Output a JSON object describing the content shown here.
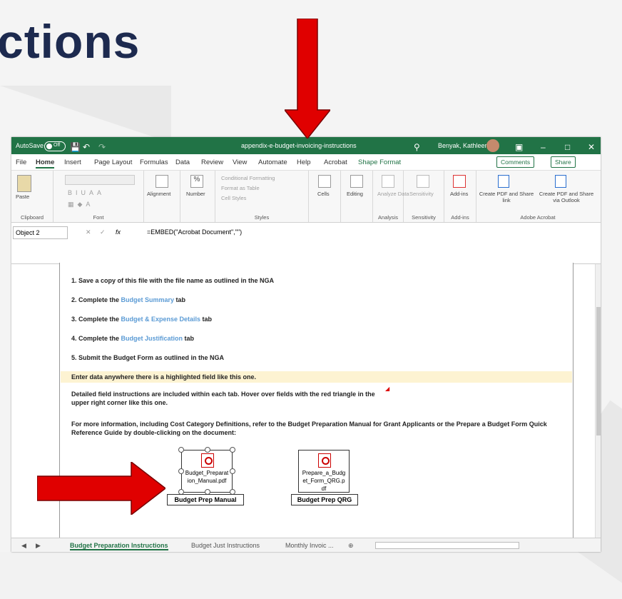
{
  "slide": {
    "title": "ctions"
  },
  "titlebar": {
    "autosave": "AutoSave",
    "toggle": "Off",
    "filename": "appendix-e-budget-invoicing-instructions",
    "user": "Benyak, Kathleen"
  },
  "menu": {
    "items": [
      "File",
      "Home",
      "Insert",
      "Page Layout",
      "Formulas",
      "Data",
      "Review",
      "View",
      "Automate",
      "Help",
      "Acrobat",
      "Shape Format"
    ],
    "comments": "Comments",
    "share": "Share"
  },
  "ribbon": {
    "paste": "Paste",
    "clipboard": "Clipboard",
    "font": "Font",
    "alignment": "Alignment",
    "number": "Number",
    "conditional": "Conditional Formatting",
    "format_table": "Format as Table",
    "cell_styles": "Cell Styles",
    "styles": "Styles",
    "cells": "Cells",
    "editing": "Editing",
    "analyze": "Analyze Data",
    "analysis": "Analysis",
    "sensitivity": "Sensitivity",
    "addins": "Add-ins",
    "create_pdf": "Create PDF and Share link",
    "create_pdf_outlook": "Create PDF and Share via Outlook",
    "adobe": "Adobe Acrobat"
  },
  "formula": {
    "namebox": "Object 2",
    "fx": "fx",
    "content": "=EMBED(\"Acrobat Document\",\"\")"
  },
  "doc": {
    "step1": "1. Save a copy of this file with the file name as outlined in the NGA",
    "step2_pre": "2. Complete the ",
    "step2_link": "Budget Summary",
    "step2_post": " tab",
    "step3_pre": "3. Complete the ",
    "step3_link": "Budget & Expense Details",
    "step3_post": " tab",
    "step4_pre": "4. Complete the ",
    "step4_link": "Budget Justification",
    "step4_post": " tab",
    "step5": "5. Submit the Budget Form as outlined in the NGA",
    "highlight": "Enter data anywhere there is a highlighted field like this one.",
    "detailed": "Detailed field instructions are included within each tab. Hover over fields with the red triangle in the upper right corner like this one.",
    "more": "For more information, including Cost Category Definitions, refer to the Budget Preparation Manual for Grant Applicants or the Prepare a Budget Form Quick Reference Guide by double-clicking on the document:",
    "pdf1_name": "Budget_Preparation_Manual.pdf",
    "pdf1_caption": "Budget Prep Manual",
    "pdf2_name": "Prepare_a_Budget_Form_QRG.pdf",
    "pdf2_caption": "Budget Prep QRG"
  },
  "sheets": {
    "tab1": "Budget Preparation Instructions",
    "tab2": "Budget Just Instructions",
    "tab3": "Monthly Invoic ..."
  },
  "colors": {
    "excel_green": "#217346",
    "arrow_red": "#e00000",
    "title_navy": "#1d2a4f",
    "link_blue": "#5b9bd5"
  }
}
